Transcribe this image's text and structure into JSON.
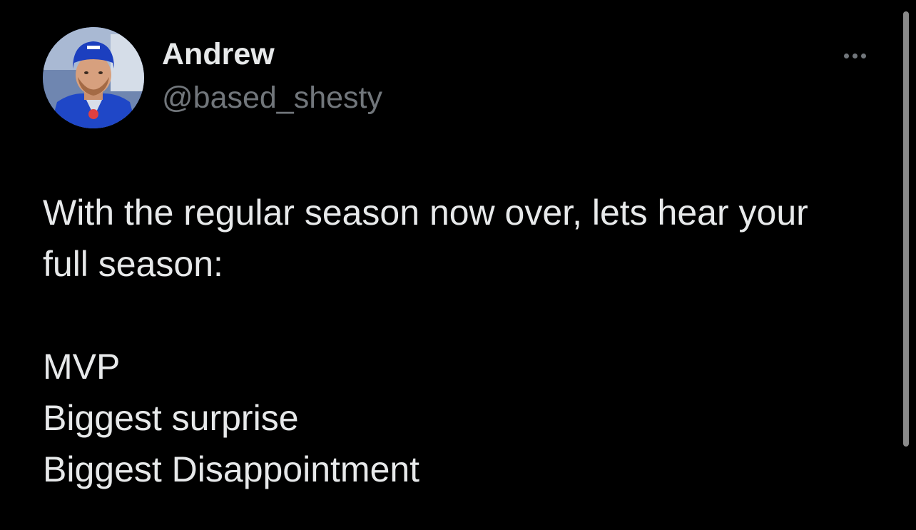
{
  "author": {
    "display_name": "Andrew",
    "handle": "@based_shesty"
  },
  "icons": {
    "more": "more-horizontal-icon",
    "avatar": "profile-avatar"
  },
  "tweet": {
    "lines": [
      "With the regular season now over, lets hear your",
      "full season:",
      "MVP",
      "Biggest surprise",
      "Biggest Disappointment"
    ]
  },
  "colors": {
    "background": "#000000",
    "primary_text": "#e7e9ea",
    "secondary_text": "#71767b"
  }
}
